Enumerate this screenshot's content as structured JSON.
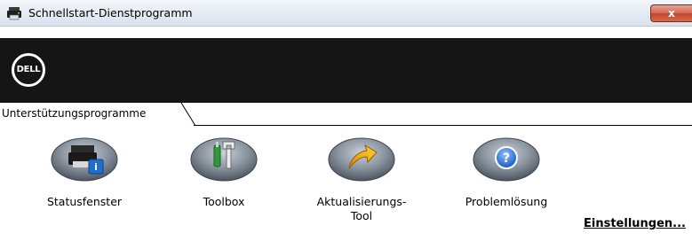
{
  "window": {
    "title": "Schnellstart-Dienstprogramm",
    "close_label": "x"
  },
  "banner": {
    "logo_text": "DELL"
  },
  "tabs": [
    {
      "label": "Unterstützungsprogramme",
      "selected": true
    }
  ],
  "tools": [
    {
      "label": "Statusfenster",
      "icon": "status-window-icon"
    },
    {
      "label": "Toolbox",
      "icon": "toolbox-icon"
    },
    {
      "label": "Aktualisierungs-\nTool",
      "icon": "update-tool-icon"
    },
    {
      "label": "Problemlösung",
      "icon": "troubleshooting-icon"
    }
  ],
  "settings_link": "Einstellungen...",
  "colors": {
    "banner": "#151515",
    "close_button": "#c4442a",
    "icon_base": "#6f7a86"
  }
}
